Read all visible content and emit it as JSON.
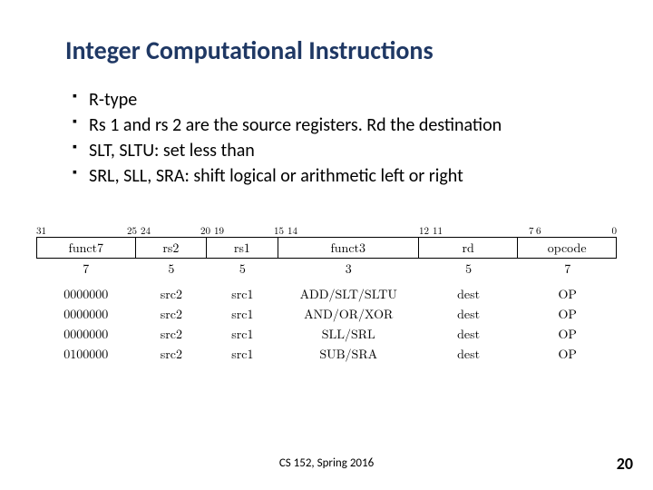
{
  "title": "Integer Computational Instructions",
  "bullets": [
    "R-type",
    "Rs 1 and rs 2 are the source registers. Rd the destination",
    "SLT, SLTU: set less than",
    "SRL, SLL, SRA: shift logical or arithmetic left or right"
  ],
  "bits": {
    "b31": "31",
    "b25": "25",
    "b24": "24",
    "b20": "20",
    "b19": "19",
    "b15": "15",
    "b14": "14",
    "b12": "12",
    "b11": "11",
    "b7": "7",
    "b6": "6",
    "b0": "0"
  },
  "fields": {
    "funct7": "funct7",
    "rs2": "rs2",
    "rs1": "rs1",
    "funct3": "funct3",
    "rd": "rd",
    "opcode": "opcode"
  },
  "widths": {
    "funct7": "7",
    "rs2": "5",
    "rs1": "5",
    "funct3": "3",
    "rd": "5",
    "opcode": "7"
  },
  "rows": [
    {
      "funct7": "0000000",
      "rs2": "src2",
      "rs1": "src1",
      "funct3": "ADD/SLT/SLTU",
      "rd": "dest",
      "opcode": "OP"
    },
    {
      "funct7": "0000000",
      "rs2": "src2",
      "rs1": "src1",
      "funct3": "AND/OR/XOR",
      "rd": "dest",
      "opcode": "OP"
    },
    {
      "funct7": "0000000",
      "rs2": "src2",
      "rs1": "src1",
      "funct3": "SLL/SRL",
      "rd": "dest",
      "opcode": "OP"
    },
    {
      "funct7": "0100000",
      "rs2": "src2",
      "rs1": "src1",
      "funct3": "SUB/SRA",
      "rd": "dest",
      "opcode": "OP"
    }
  ],
  "footer": "CS 152, Spring 2016",
  "page": "20"
}
